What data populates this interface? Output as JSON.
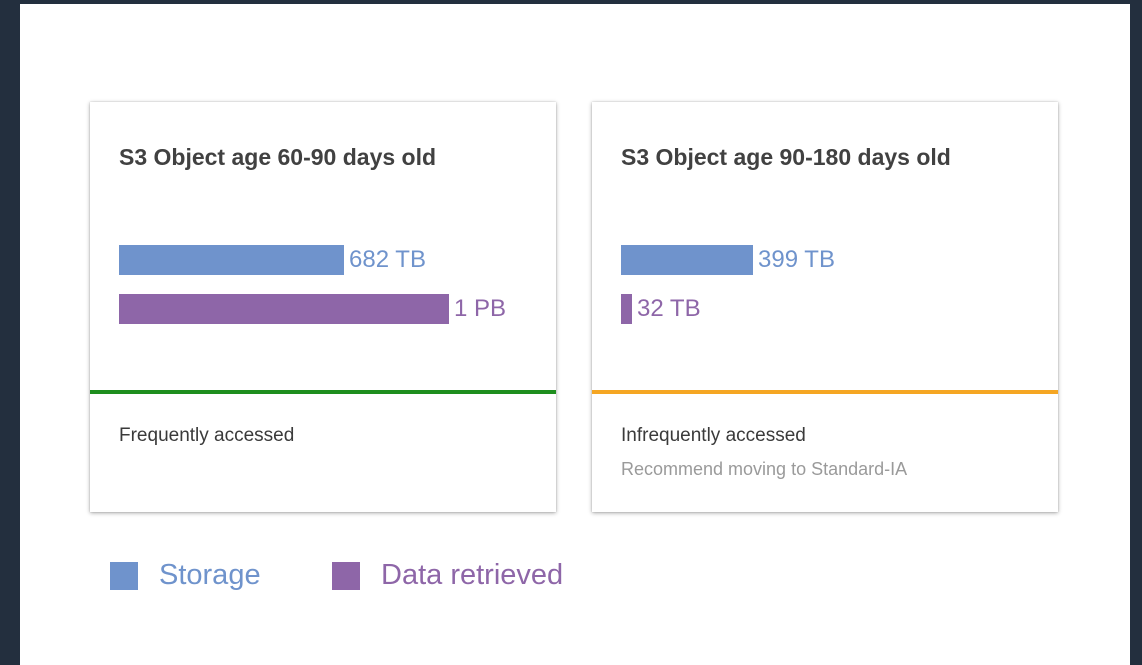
{
  "cards": [
    {
      "title": "S3 Object age 60-90 days old",
      "storage": {
        "value": 682,
        "label": "682 TB"
      },
      "retrieved": {
        "value": 1000,
        "label": "1 PB"
      },
      "status_label": "Frequently accessed",
      "status_color": "#1e8e1e",
      "recommendation": ""
    },
    {
      "title": "S3 Object age 90-180 days old",
      "storage": {
        "value": 399,
        "label": "399 TB"
      },
      "retrieved": {
        "value": 32,
        "label": "32 TB"
      },
      "status_label": "Infrequently accessed",
      "status_color": "#f5a623",
      "recommendation": "Recommend moving to Standard-IA"
    }
  ],
  "legend": {
    "storage": {
      "label": "Storage",
      "color": "#6f93cc"
    },
    "retrieved": {
      "label": "Data retrieved",
      "color": "#8e66a8"
    }
  }
}
